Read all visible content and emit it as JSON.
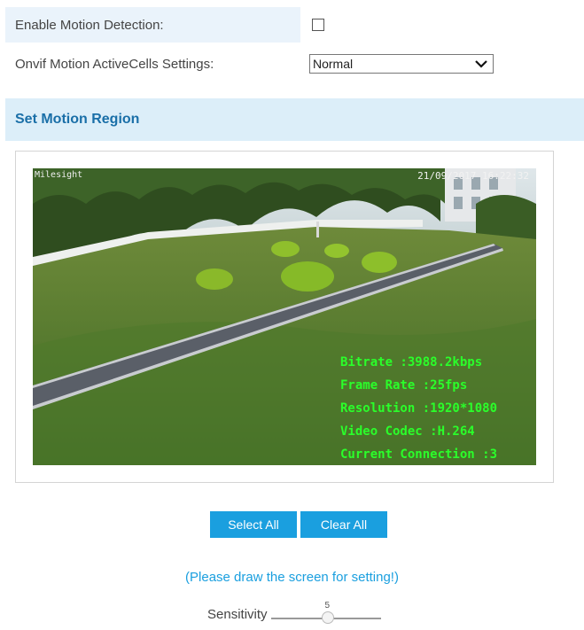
{
  "settings": {
    "motion_detection_label": "Enable Motion Detection:",
    "motion_detection_checked": false,
    "active_cells_label": "Onvif Motion ActiveCells Settings:",
    "active_cells_value": "Normal"
  },
  "section": {
    "title": "Set Motion Region"
  },
  "video": {
    "osd": {
      "bitrate": "Bitrate :3988.2kbps",
      "frame_rate": "Frame Rate :25fps",
      "resolution": "Resolution :1920*1080",
      "codec": "Video Codec :H.264",
      "connection": "Current Connection :3"
    }
  },
  "buttons": {
    "select_all": "Select All",
    "clear_all": "Clear All"
  },
  "hint": "(Please draw the screen for setting!)",
  "sensitivity": {
    "label": "Sensitivity",
    "value": "5"
  },
  "colors": {
    "accent": "#1a9fdf",
    "header_bg": "#dceef9",
    "osd_text": "#2aff2a"
  }
}
